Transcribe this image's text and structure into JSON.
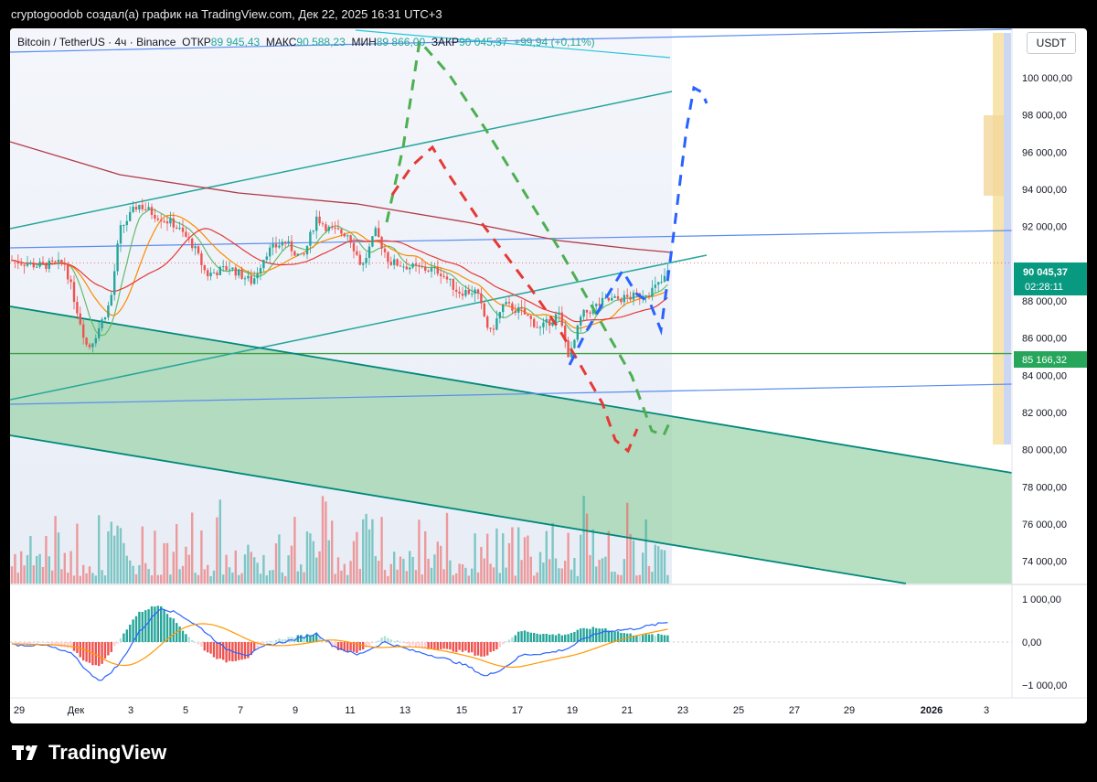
{
  "caption": "cryptogoodob создал(а) график на TradingView.com, Дек 22, 2025 16:31 UTC+3",
  "legend": {
    "symbol": "Bitcoin / TetherUS · 4ч · Binance",
    "open_label": "ОТКР",
    "open_value": "89 945,43",
    "high_label": "МАКС",
    "high_value": "90 588,23",
    "low_label": "МИН",
    "low_value": "89 866,00",
    "close_label": "ЗАКР",
    "close_value": "90 045,37",
    "change": "+99,94 (+0,11%)"
  },
  "currency": "USDT",
  "price_axis": [
    "100 000,00",
    "98 000,00",
    "96 000,00",
    "94 000,00",
    "92 000,00",
    "88 000,00",
    "86 000,00",
    "84 000,00",
    "82 000,00",
    "80 000,00",
    "78 000,00",
    "76 000,00",
    "74 000,00"
  ],
  "last_price": {
    "value": "90 045,37",
    "countdown": "02:28:11"
  },
  "support_level": "85 166,32",
  "macd_axis": [
    "1 000,00",
    "0,00",
    "−1 000,00"
  ],
  "time_axis": [
    "29",
    "Дек",
    "3",
    "5",
    "7",
    "9",
    "11",
    "13",
    "15",
    "17",
    "19",
    "21",
    "23",
    "25",
    "27",
    "29",
    "2026",
    "3"
  ],
  "brand": "TradingView",
  "colors": {
    "up": "#26a69a",
    "down": "#ef5350",
    "fill": "#9fd4ad",
    "projection_green": "#4caf50",
    "projection_red": "#e53935",
    "projection_blue": "#2962ff"
  },
  "chart_data": {
    "type": "candlestick",
    "symbol": "BTC/USDT",
    "timeframe": "4ч",
    "ylim": [
      72800,
      103000
    ],
    "x": [
      "2025-11-29",
      "2025-12-01",
      "2025-12-03",
      "2025-12-05",
      "2025-12-07",
      "2025-12-09",
      "2025-12-11",
      "2025-12-13",
      "2025-12-15",
      "2025-12-17",
      "2025-12-19",
      "2025-12-21",
      "2025-12-22"
    ],
    "close": [
      89800,
      87000,
      93000,
      92000,
      89500,
      91500,
      92300,
      90300,
      89000,
      87600,
      87900,
      88400,
      90045
    ],
    "high": [
      91000,
      91500,
      94200,
      93300,
      91500,
      94300,
      94100,
      92600,
      90200,
      89800,
      89400,
      88900,
      90588
    ],
    "low": [
      89000,
      84000,
      90600,
      90200,
      88500,
      89500,
      90200,
      89900,
      85200,
      85000,
      84600,
      87800,
      89866
    ],
    "horizontal_level": 85166.32,
    "macd_range": [
      -1250,
      1250
    ]
  }
}
